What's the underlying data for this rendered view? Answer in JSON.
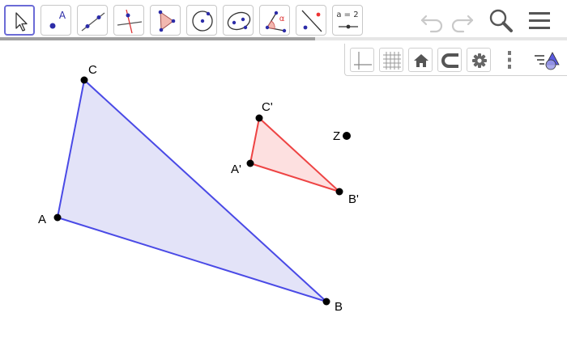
{
  "toolbar": {
    "tools": [
      {
        "name": "move-tool",
        "icon": "arrow-cursor-icon",
        "selected": true
      },
      {
        "name": "point-tool",
        "icon": "point-icon",
        "label": "A"
      },
      {
        "name": "line-tool",
        "icon": "line-icon"
      },
      {
        "name": "perpendicular-tool",
        "icon": "perpendicular-line-icon"
      },
      {
        "name": "polygon-tool",
        "icon": "polygon-icon"
      },
      {
        "name": "circle-tool",
        "icon": "circle-icon"
      },
      {
        "name": "ellipse-tool",
        "icon": "ellipse-icon"
      },
      {
        "name": "angle-tool",
        "icon": "angle-icon",
        "label": "α"
      },
      {
        "name": "reflect-tool",
        "icon": "reflect-icon"
      },
      {
        "name": "slider-tool",
        "icon": "slider-icon",
        "label": "a = 2"
      }
    ],
    "right_icons": [
      "undo-icon",
      "redo-icon",
      "search-icon",
      "menu-icon"
    ],
    "progress": 0.555
  },
  "style_bar": {
    "buttons": [
      "axes-icon",
      "grid-icon",
      "home-icon",
      "magnet-icon",
      "settings-icon",
      "more-icon",
      "style-bar-toggle-icon"
    ]
  },
  "graphics": {
    "colors": {
      "big_triangle": "#4a4ae6",
      "big_fill": "#e3e3f8",
      "small_triangle": "#ee4444",
      "small_fill": "#fde0e0",
      "point": "#000000"
    },
    "points": [
      {
        "id": "A",
        "label": "A"
      },
      {
        "id": "B",
        "label": "B"
      },
      {
        "id": "C",
        "label": "C"
      },
      {
        "id": "Ap",
        "label": "A'"
      },
      {
        "id": "Bp",
        "label": "B'"
      },
      {
        "id": "Cp",
        "label": "C'"
      },
      {
        "id": "Z",
        "label": "Z"
      }
    ]
  }
}
